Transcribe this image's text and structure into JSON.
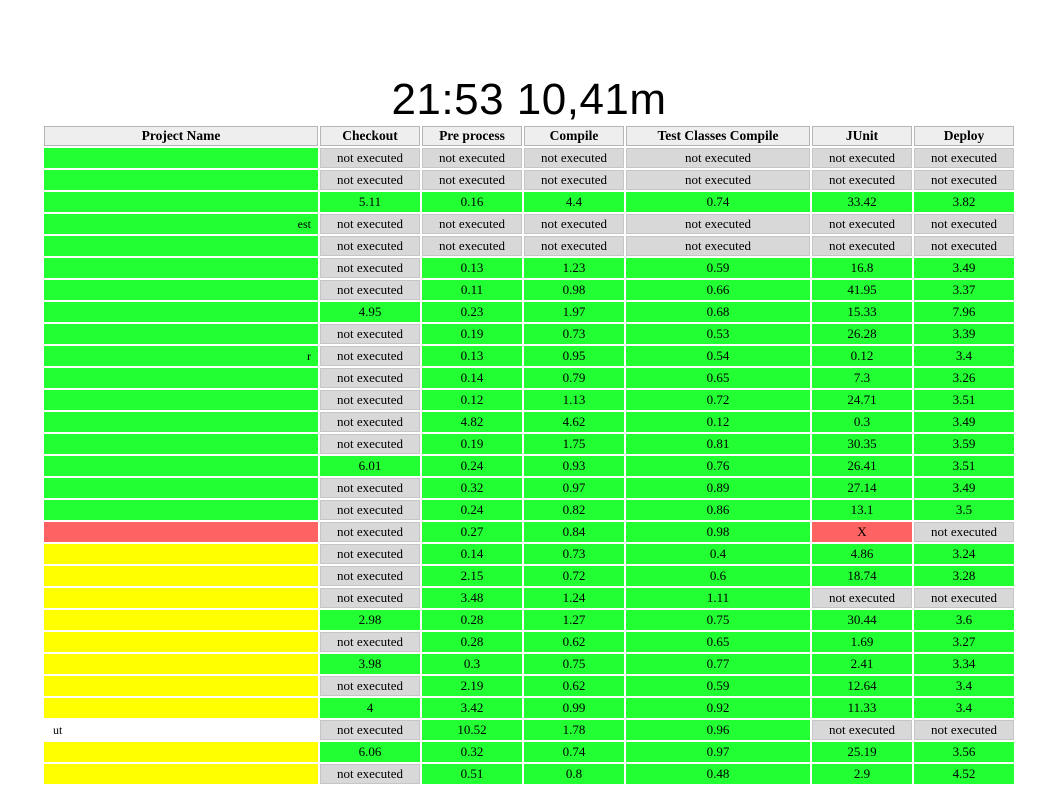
{
  "slide": {
    "title": "21:53 10,41m"
  },
  "colors": {
    "ok": "#22ff33",
    "not_executed": "#d8d8d8",
    "failed": "#ff6262",
    "unstable": "#ffff00"
  },
  "table": {
    "headers": [
      "Project Name",
      "Checkout",
      "Pre process",
      "Compile",
      "Test Classes Compile",
      "JUnit",
      "Deploy"
    ],
    "rows": [
      {
        "name": "",
        "name_color": "green",
        "cells": [
          "not executed",
          "not executed",
          "not executed",
          "not executed",
          "not executed",
          "not executed"
        ]
      },
      {
        "name": "",
        "name_color": "green",
        "cells": [
          "not executed",
          "not executed",
          "not executed",
          "not executed",
          "not executed",
          "not executed"
        ]
      },
      {
        "name": "",
        "name_color": "green",
        "cells": [
          "5.11",
          "0.16",
          "4.4",
          "0.74",
          "33.42",
          "3.82"
        ]
      },
      {
        "name": "est",
        "name_color": "green",
        "cells": [
          "not executed",
          "not executed",
          "not executed",
          "not executed",
          "not executed",
          "not executed"
        ]
      },
      {
        "name": "",
        "name_color": "green",
        "cells": [
          "not executed",
          "not executed",
          "not executed",
          "not executed",
          "not executed",
          "not executed"
        ]
      },
      {
        "name": "",
        "name_color": "green",
        "cells": [
          "not executed",
          "0.13",
          "1.23",
          "0.59",
          "16.8",
          "3.49"
        ]
      },
      {
        "name": "",
        "name_color": "green",
        "cells": [
          "not executed",
          "0.11",
          "0.98",
          "0.66",
          "41.95",
          "3.37"
        ]
      },
      {
        "name": "",
        "name_color": "green",
        "cells": [
          "4.95",
          "0.23",
          "1.97",
          "0.68",
          "15.33",
          "7.96"
        ]
      },
      {
        "name": "",
        "name_color": "green",
        "cells": [
          "not executed",
          "0.19",
          "0.73",
          "0.53",
          "26.28",
          "3.39"
        ]
      },
      {
        "name": "r",
        "name_color": "green",
        "cells": [
          "not executed",
          "0.13",
          "0.95",
          "0.54",
          "0.12",
          "3.4"
        ]
      },
      {
        "name": "",
        "name_color": "green",
        "cells": [
          "not executed",
          "0.14",
          "0.79",
          "0.65",
          "7.3",
          "3.26"
        ]
      },
      {
        "name": "",
        "name_color": "green",
        "cells": [
          "not executed",
          "0.12",
          "1.13",
          "0.72",
          "24.71",
          "3.51"
        ]
      },
      {
        "name": "",
        "name_color": "green",
        "cells": [
          "not executed",
          "4.82",
          "4.62",
          "0.12",
          "0.3",
          "3.49"
        ]
      },
      {
        "name": "",
        "name_color": "green",
        "cells": [
          "not executed",
          "0.19",
          "1.75",
          "0.81",
          "30.35",
          "3.59"
        ]
      },
      {
        "name": "",
        "name_color": "green",
        "cells": [
          "6.01",
          "0.24",
          "0.93",
          "0.76",
          "26.41",
          "3.51"
        ]
      },
      {
        "name": "",
        "name_color": "green",
        "cells": [
          "not executed",
          "0.32",
          "0.97",
          "0.89",
          "27.14",
          "3.49"
        ]
      },
      {
        "name": "",
        "name_color": "green",
        "cells": [
          "not executed",
          "0.24",
          "0.82",
          "0.86",
          "13.1",
          "3.5"
        ]
      },
      {
        "name": "",
        "name_color": "red",
        "cells": [
          "not executed",
          "0.27",
          "0.84",
          "0.98",
          "X",
          "not executed"
        ]
      },
      {
        "name": "",
        "name_color": "yellow",
        "cells": [
          "not executed",
          "0.14",
          "0.73",
          "0.4",
          "4.86",
          "3.24"
        ]
      },
      {
        "name": "",
        "name_color": "yellow",
        "cells": [
          "not executed",
          "2.15",
          "0.72",
          "0.6",
          "18.74",
          "3.28"
        ]
      },
      {
        "name": "",
        "name_color": "yellow",
        "cells": [
          "not executed",
          "3.48",
          "1.24",
          "1.11",
          "not executed",
          "not executed"
        ]
      },
      {
        "name": "",
        "name_color": "yellow",
        "cells": [
          "2.98",
          "0.28",
          "1.27",
          "0.75",
          "30.44",
          "3.6"
        ]
      },
      {
        "name": "",
        "name_color": "yellow",
        "cells": [
          "not executed",
          "0.28",
          "0.62",
          "0.65",
          "1.69",
          "3.27"
        ]
      },
      {
        "name": "",
        "name_color": "yellow",
        "cells": [
          "3.98",
          "0.3",
          "0.75",
          "0.77",
          "2.41",
          "3.34"
        ]
      },
      {
        "name": "",
        "name_color": "yellow",
        "cells": [
          "not executed",
          "2.19",
          "0.62",
          "0.59",
          "12.64",
          "3.4"
        ]
      },
      {
        "name": "",
        "name_color": "yellow",
        "cells": [
          "4",
          "3.42",
          "0.99",
          "0.92",
          "11.33",
          "3.4"
        ]
      },
      {
        "name": "ut",
        "name_color": "white",
        "name_align": "left",
        "cells": [
          "not executed",
          "10.52",
          "1.78",
          "0.96",
          "not executed",
          "not executed"
        ]
      },
      {
        "name": "",
        "name_color": "yellow",
        "cells": [
          "6.06",
          "0.32",
          "0.74",
          "0.97",
          "25.19",
          "3.56"
        ]
      },
      {
        "name": "",
        "name_color": "yellow",
        "cells": [
          "not executed",
          "0.51",
          "0.8",
          "0.48",
          "2.9",
          "4.52"
        ]
      }
    ]
  }
}
